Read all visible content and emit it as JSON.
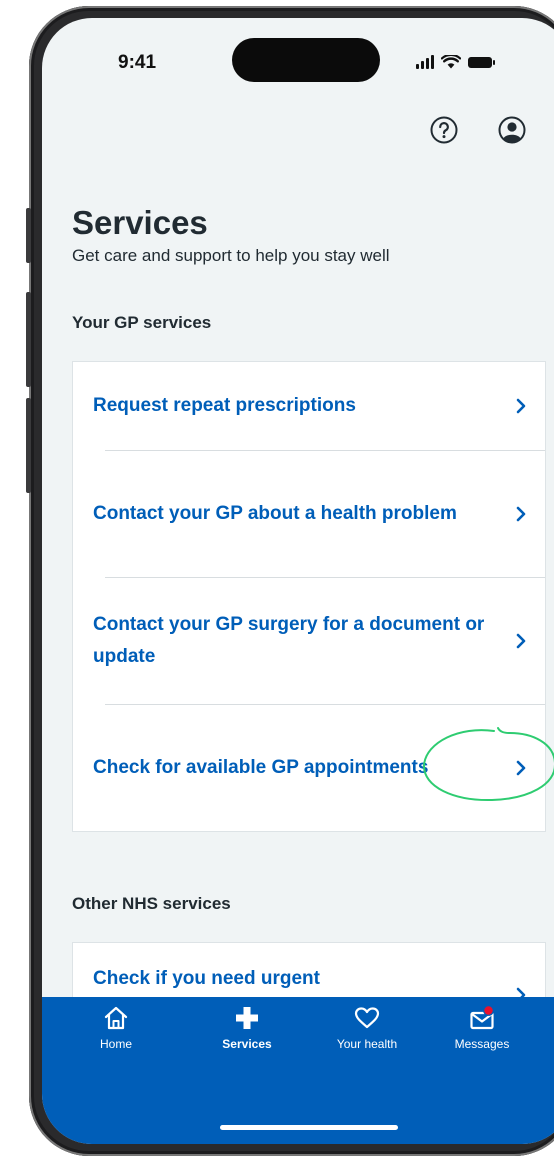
{
  "status_bar": {
    "time": "9:41"
  },
  "header": {
    "help_icon": "help-circle-icon",
    "account_icon": "account-icon"
  },
  "page": {
    "title": "Services",
    "subtitle": "Get care and support to help you stay well"
  },
  "gp_section": {
    "heading": "Your GP services",
    "items": [
      {
        "label": "Request repeat prescriptions"
      },
      {
        "label": "Contact your GP about a health problem"
      },
      {
        "label": "Contact your GP surgery for a document or update"
      },
      {
        "label": "Check for available GP appointments"
      }
    ]
  },
  "other_section": {
    "heading": "Other NHS services",
    "items": [
      {
        "label": "Check if you need urgent"
      }
    ]
  },
  "annotation": {
    "color": "#2ecc71"
  },
  "bottom_nav": {
    "items": [
      {
        "label": "Home",
        "icon": "home-icon",
        "active": false
      },
      {
        "label": "Services",
        "icon": "plus-icon",
        "active": true
      },
      {
        "label": "Your health",
        "icon": "heart-icon",
        "active": false
      },
      {
        "label": "Messages",
        "icon": "mail-icon",
        "active": false
      }
    ]
  },
  "colors": {
    "nhs_blue": "#005eb8",
    "background": "#f0f4f5",
    "text": "#212b32",
    "notification_dot": "#e8112d"
  }
}
